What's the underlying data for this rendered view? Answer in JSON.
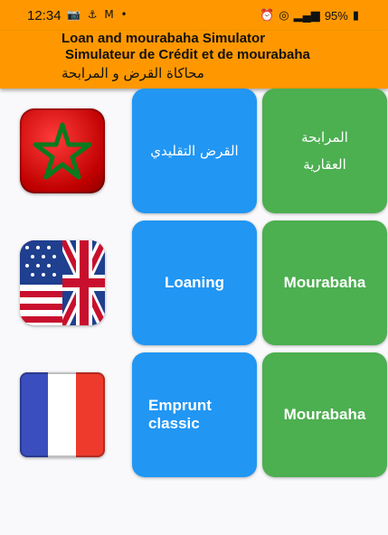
{
  "status": {
    "time": "12:34",
    "left_icons": "📷 ⚓ M •",
    "battery": "95%"
  },
  "header": {
    "title_en": "Loan and mourabaha Simulator",
    "title_fr": "Simulateur de Crédit et de mourabaha",
    "title_ar": "محاكاة القرض و المرابحة"
  },
  "rows": [
    {
      "flag": "morocco-flag",
      "loan": "القرض التقليدي",
      "mourabaha": "المرابحة العقارية"
    },
    {
      "flag": "uk-us-flag",
      "loan": "Loaning",
      "mourabaha": "Mourabaha"
    },
    {
      "flag": "france-flag",
      "loan": "Emprunt classic",
      "mourabaha": "Mourabaha"
    }
  ],
  "colors": {
    "appbar": "#ff9800",
    "loan_card": "#2196f3",
    "mourabaha_card": "#4caf50"
  }
}
